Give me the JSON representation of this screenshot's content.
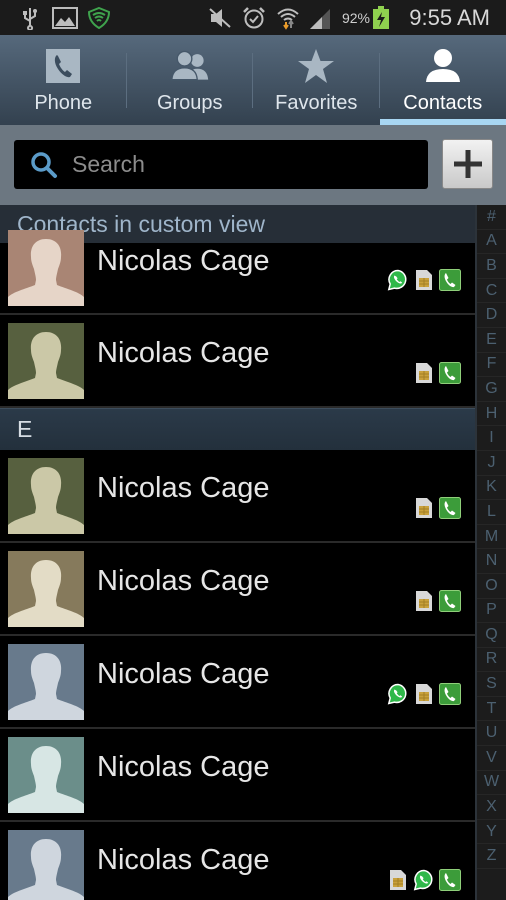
{
  "status_bar": {
    "left_icons": [
      "usb-icon",
      "gallery-icon",
      "security-shield-icon"
    ],
    "right_icons": [
      "mute-icon",
      "alarm-icon",
      "wifi-icon",
      "signal-icon"
    ],
    "battery_percent": "92%",
    "time": "9:55 AM"
  },
  "tabs": [
    {
      "label": "Phone",
      "icon": "phone-icon",
      "active": false
    },
    {
      "label": "Groups",
      "icon": "groups-icon",
      "active": false
    },
    {
      "label": "Favorites",
      "icon": "star-icon",
      "active": false
    },
    {
      "label": "Contacts",
      "icon": "person-icon",
      "active": true
    }
  ],
  "search": {
    "placeholder": "Search",
    "value": ""
  },
  "list": {
    "header": "Contacts in custom view",
    "section_E": "E",
    "contacts_before": [
      {
        "name": "Nicolas Cage",
        "avatar_bg": "#a98574",
        "avatar_fg": "#e6d5c8",
        "badges": [
          "whatsapp",
          "sim",
          "call"
        ]
      },
      {
        "name": "Nicolas Cage",
        "avatar_bg": "#57603f",
        "avatar_fg": "#cbc8a7",
        "badges": [
          "sim",
          "call"
        ]
      }
    ],
    "contacts_after": [
      {
        "name": "Nicolas Cage",
        "avatar_bg": "#57603f",
        "avatar_fg": "#cbc8a7",
        "badges": [
          "sim",
          "call"
        ]
      },
      {
        "name": "Nicolas Cage",
        "avatar_bg": "#867a5c",
        "avatar_fg": "#e3dcc6",
        "badges": [
          "sim",
          "call"
        ]
      },
      {
        "name": "Nicolas Cage",
        "avatar_bg": "#687a8c",
        "avatar_fg": "#cfd6de",
        "badges": [
          "whatsapp",
          "sim",
          "call"
        ]
      },
      {
        "name": "Nicolas Cage",
        "avatar_bg": "#6b8e8a",
        "avatar_fg": "#d7e6e4",
        "badges": []
      },
      {
        "name": "Nicolas Cage",
        "avatar_bg": "#687a8c",
        "avatar_fg": "#cfd6de",
        "badges": [
          "sim",
          "whatsapp",
          "call"
        ]
      }
    ]
  },
  "index_letters": [
    "#",
    "A",
    "B",
    "C",
    "D",
    "E",
    "F",
    "G",
    "H",
    "I",
    "J",
    "K",
    "L",
    "M",
    "N",
    "O",
    "P",
    "Q",
    "R",
    "S",
    "T",
    "U",
    "V",
    "W",
    "X",
    "Y",
    "Z"
  ],
  "colors": {
    "accent": "#a8d6f2",
    "tab_bar_top": "#56697c",
    "tab_bar_bottom": "#33414f",
    "search_area": "#6c7781",
    "search_icon": "#5b9bc8"
  }
}
